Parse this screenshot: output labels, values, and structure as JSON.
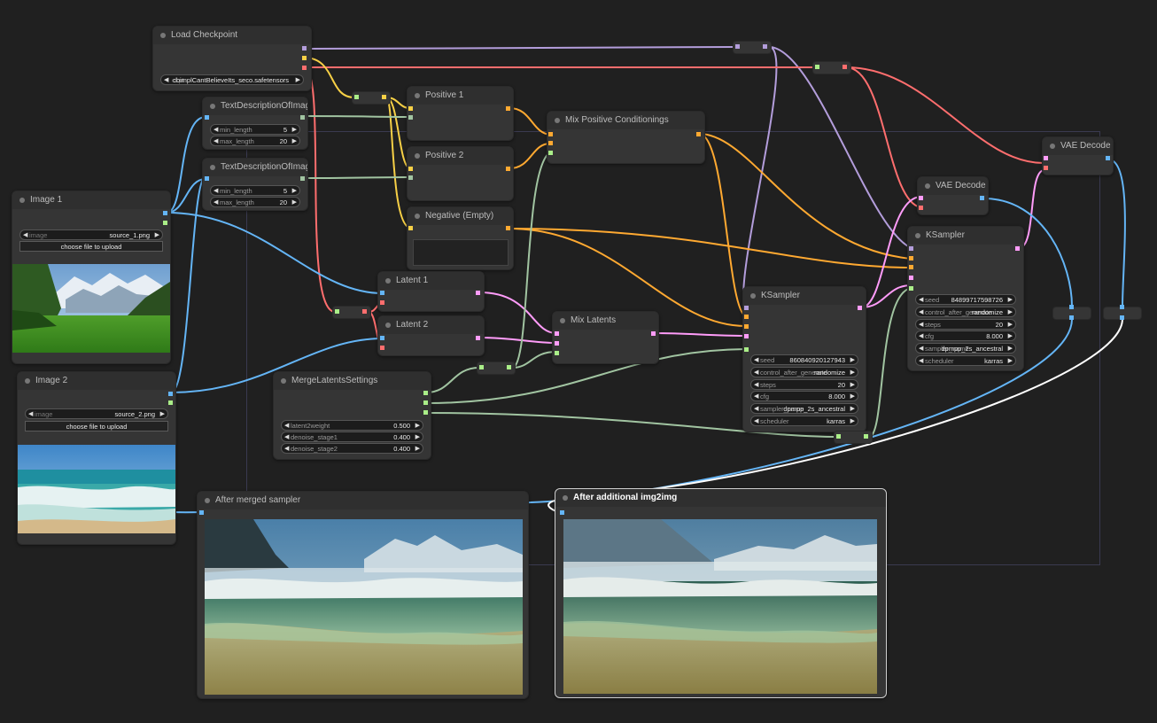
{
  "colors": {
    "clip": "#f7d046",
    "model": "#b39ddb",
    "vae": "#ff6e6e",
    "conditioning": "#ffa931",
    "latent": "#ff9cf9",
    "image": "#64b5f6",
    "string": "#a1c4a1",
    "float": "#aaee88",
    "background": "#202020"
  },
  "nodes": {
    "load_checkpoint": {
      "title": "Load Checkpoint",
      "ckpt_label": "ckpt",
      "ckpt_value": "cbimplCantBelieveIts_seco.safetensors"
    },
    "text_desc_1": {
      "title": "TextDescriptionOfImage",
      "min_label": "min_length",
      "min_value": "5",
      "max_label": "max_length",
      "max_value": "20"
    },
    "text_desc_2": {
      "title": "TextDescriptionOfImage",
      "min_label": "min_length",
      "min_value": "5",
      "max_label": "max_length",
      "max_value": "20"
    },
    "image1": {
      "title": "Image 1",
      "label": "image",
      "value": "source_1.png",
      "upload": "choose file to upload"
    },
    "image2": {
      "title": "Image 2",
      "label": "image",
      "value": "source_2.png",
      "upload": "choose file to upload"
    },
    "positive1": {
      "title": "Positive 1"
    },
    "positive2": {
      "title": "Positive 2"
    },
    "negative": {
      "title": "Negative (Empty)"
    },
    "mix_positive": {
      "title": "Mix Positive Conditionings"
    },
    "latent1": {
      "title": "Latent 1"
    },
    "latent2": {
      "title": "Latent 2"
    },
    "mix_latents": {
      "title": "Mix Latents"
    },
    "merge_settings": {
      "title": "MergeLatentsSettings",
      "w1_label": "latent2weight",
      "w1_value": "0.500",
      "w2_label": "denoise_stage1",
      "w2_value": "0.400",
      "w3_label": "denoise_stage2",
      "w3_value": "0.400"
    },
    "ksampler1": {
      "title": "KSampler",
      "seed_label": "seed",
      "seed_value": "860840920127943",
      "caf_label": "control_after_generate",
      "caf_value": "randomize",
      "steps_label": "steps",
      "steps_value": "20",
      "cfg_label": "cfg",
      "cfg_value": "8.000",
      "sampler_label": "sampler_name",
      "sampler_value": "dpmpp_2s_ancestral",
      "scheduler_label": "scheduler",
      "scheduler_value": "karras"
    },
    "ksampler2": {
      "title": "KSampler",
      "seed_label": "seed",
      "seed_value": "848997175987​26",
      "caf_label": "control_after_generate",
      "caf_value": "randomize",
      "steps_label": "steps",
      "steps_value": "20",
      "cfg_label": "cfg",
      "cfg_value": "8.000",
      "sampler_label": "sampler_name",
      "sampler_value": "dpmpp_2s_ancestral",
      "scheduler_label": "scheduler",
      "scheduler_value": "karras"
    },
    "vae_decode1": {
      "title": "VAE Decode"
    },
    "vae_decode2": {
      "title": "VAE Decode"
    },
    "after_merged": {
      "title": "After merged sampler"
    },
    "after_img2img": {
      "title": "After additional img2img"
    }
  }
}
